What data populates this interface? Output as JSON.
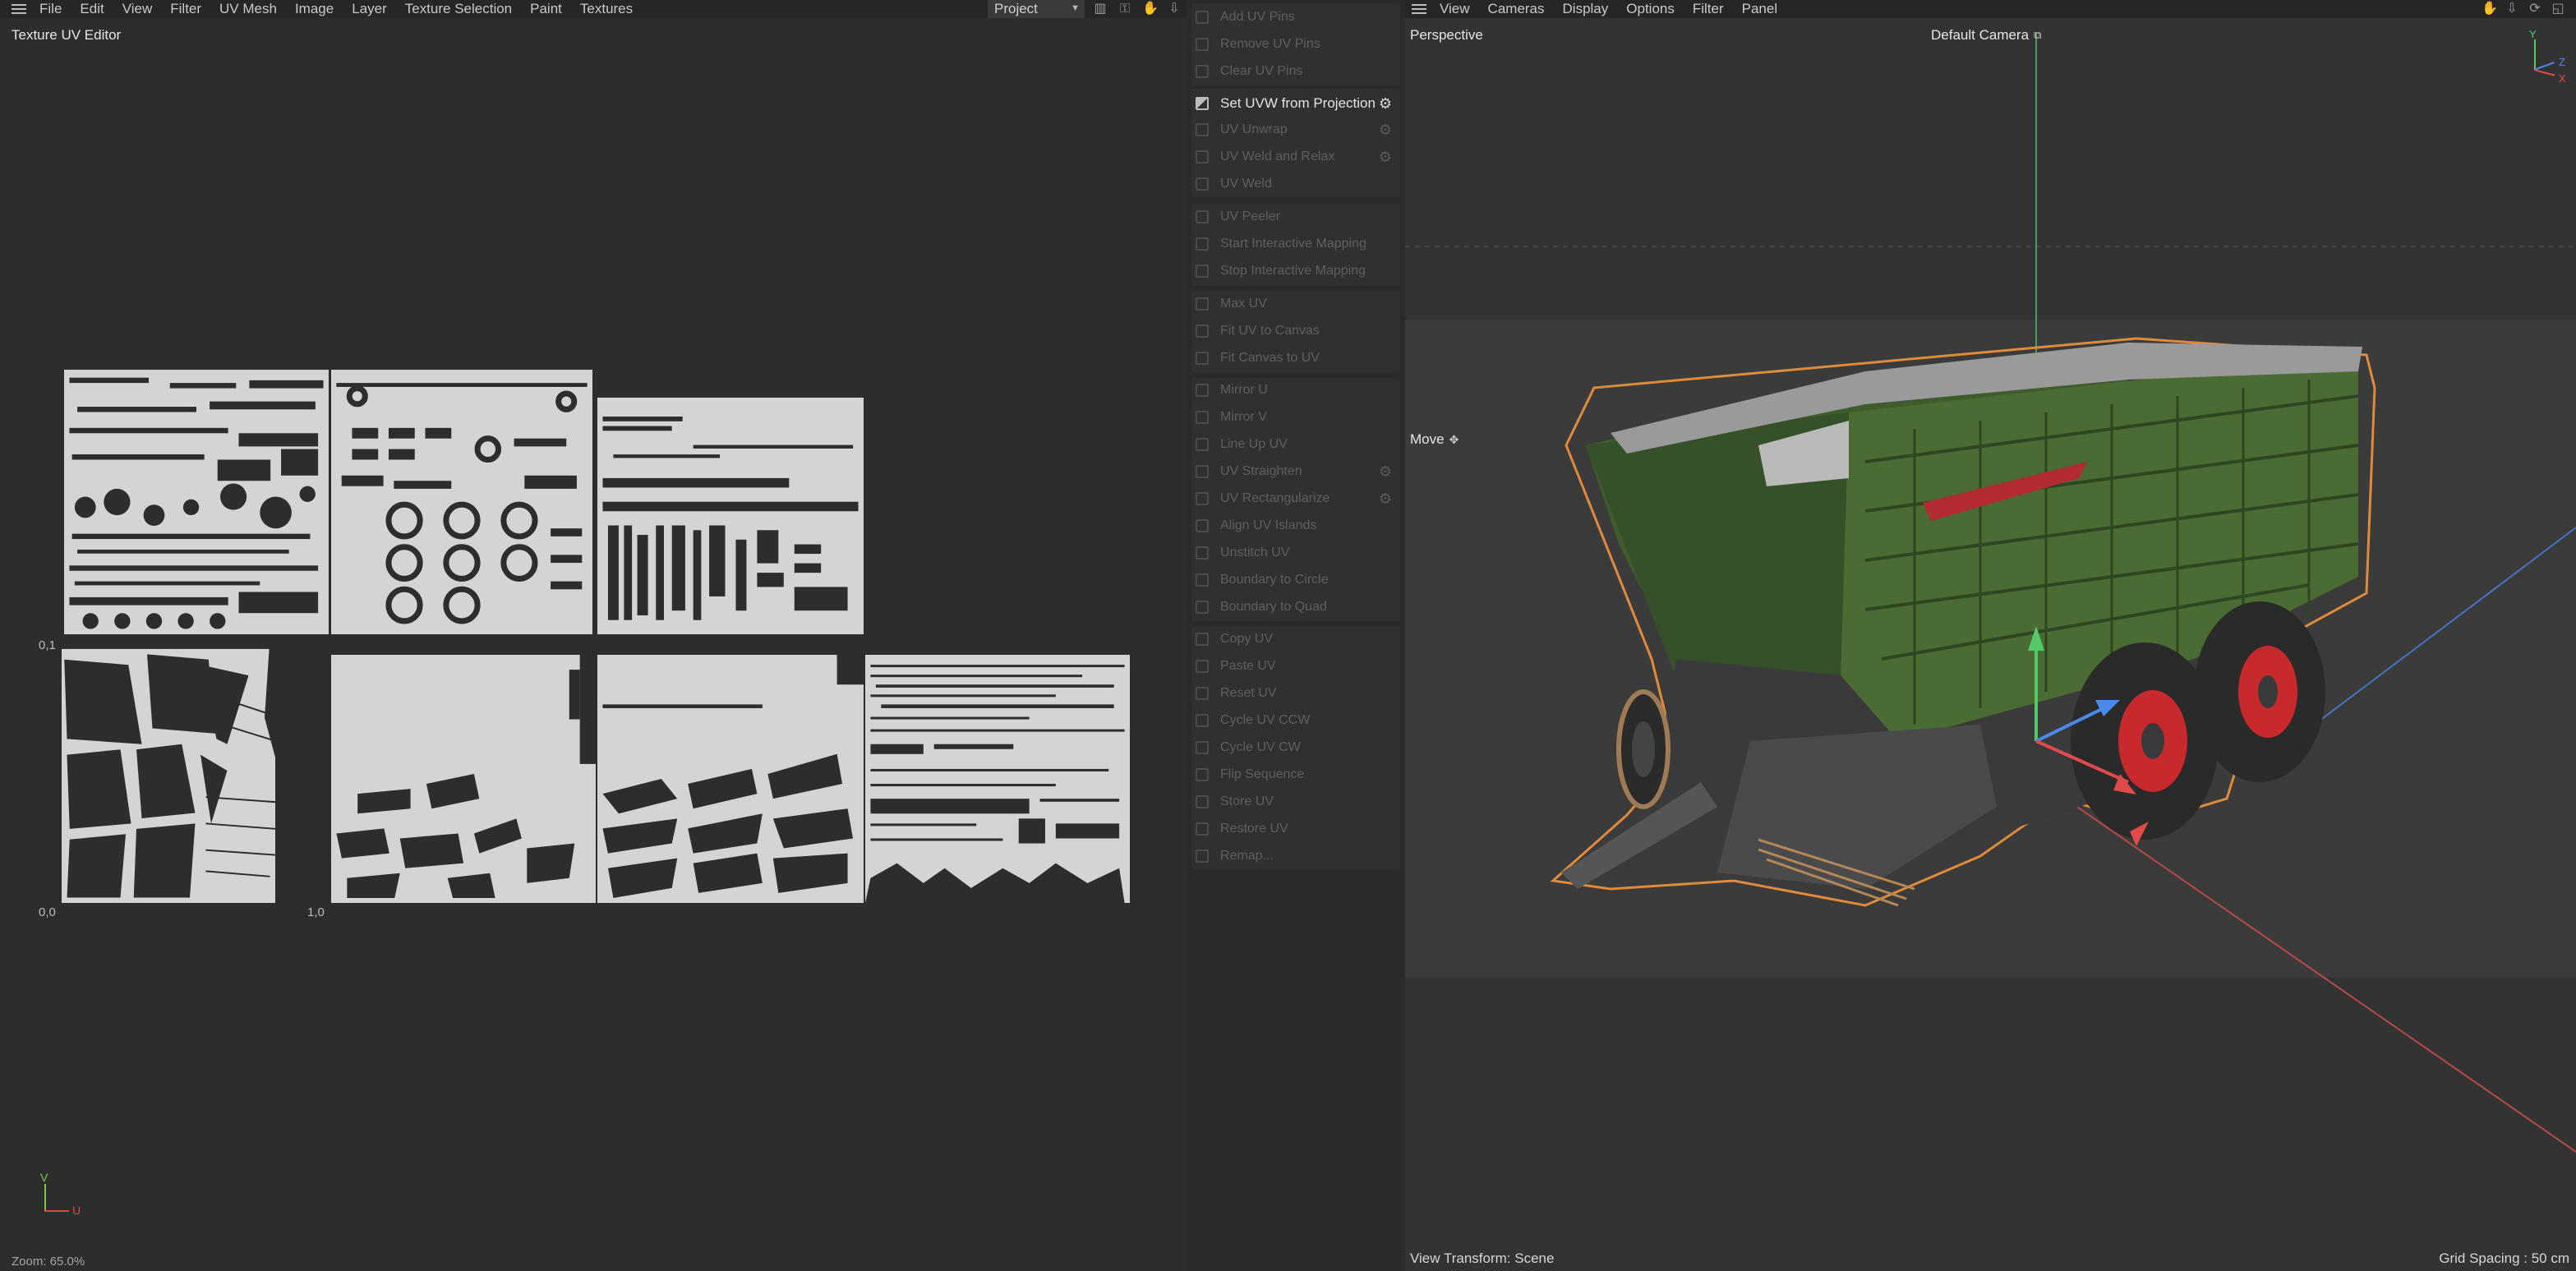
{
  "uv_editor": {
    "menu": [
      "File",
      "Edit",
      "View",
      "Filter",
      "UV Mesh",
      "Image",
      "Layer",
      "Texture Selection",
      "Paint",
      "Textures"
    ],
    "project_dropdown": "Project",
    "title": "Texture UV Editor",
    "axis_labels": {
      "origin": "0,0",
      "u_one": "1,0",
      "v_one": "0,1"
    },
    "axis_gizmo": {
      "v": "V",
      "u": "U"
    },
    "zoom": "Zoom: 65.0%"
  },
  "palette": {
    "commands": [
      "Add UV Pins",
      "Remove UV Pins",
      "Clear UV Pins",
      "Set UVW from Projection",
      "UV Unwrap",
      "UV Weld and Relax",
      "UV Weld",
      "UV Peeler",
      "Start Interactive Mapping",
      "Stop Interactive Mapping",
      "Max UV",
      "Fit UV to Canvas",
      "Fit Canvas to UV",
      "Mirror U",
      "Mirror V",
      "Line Up UV",
      "UV Straighten",
      "UV Rectangularize",
      "Align UV Islands",
      "Unstitch UV",
      "Boundary to Circle",
      "Boundary to Quad",
      "Copy UV",
      "Paste UV",
      "Reset UV",
      "Cycle UV CCW",
      "Cycle UV CW",
      "Flip Sequence",
      "Store UV",
      "Restore UV",
      "Remap..."
    ],
    "active_command": "Set UVW from Projection"
  },
  "viewport": {
    "menu": [
      "View",
      "Cameras",
      "Display",
      "Options",
      "Filter",
      "Panel"
    ],
    "view_name": "Perspective",
    "camera": "Default Camera",
    "tool_label": "Move",
    "view_transform": "View Transform: Scene",
    "grid_spacing": "Grid Spacing : 50 cm",
    "axis_gizmo": {
      "y": "Y",
      "z": "Z",
      "x": "X"
    },
    "colors": {
      "body_green": "#3f5c2b",
      "wheel_red": "#c7292c",
      "selection_orange": "#e08a3c"
    }
  }
}
